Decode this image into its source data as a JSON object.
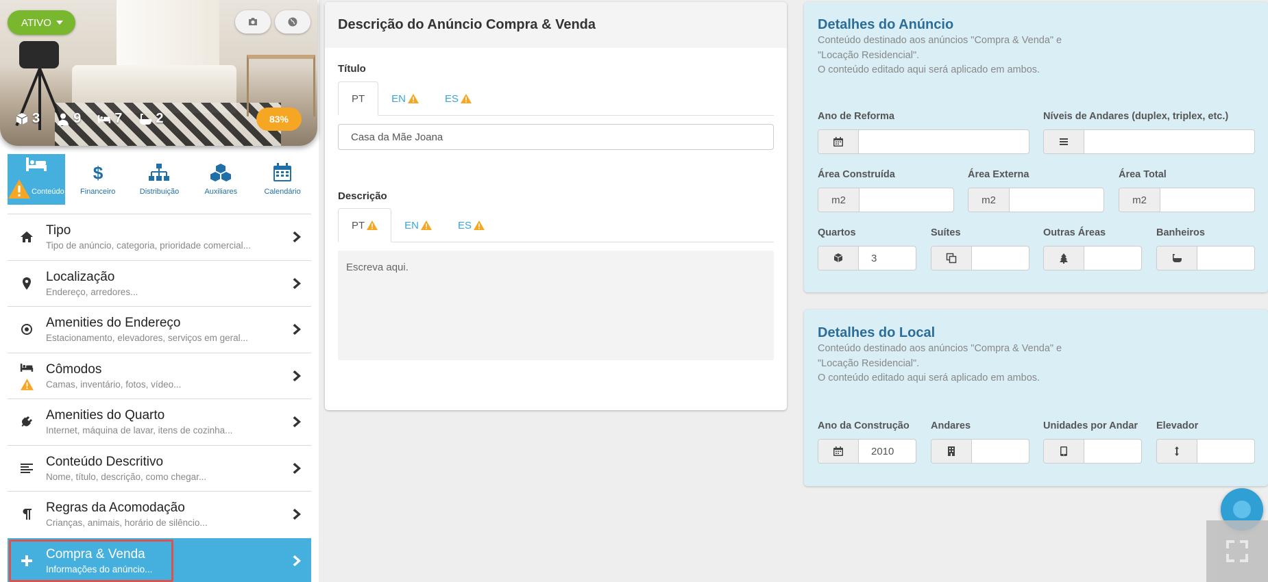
{
  "property": {
    "status_label": "ATIVO",
    "stats": [
      {
        "icon": "cube-icon",
        "value": "3"
      },
      {
        "icon": "person-icon",
        "value": "9"
      },
      {
        "icon": "bed-icon",
        "value": "7"
      },
      {
        "icon": "bathtub-icon",
        "value": "2"
      }
    ],
    "progress": "83%",
    "progress_value": 83
  },
  "tabs": [
    {
      "label": "Conteúdo",
      "icon": "bed-icon",
      "active": true,
      "warning": true
    },
    {
      "label": "Financeiro",
      "icon": "dollar-icon"
    },
    {
      "label": "Distribuição",
      "icon": "sitemap-icon"
    },
    {
      "label": "Auxiliares",
      "icon": "cubes-icon"
    },
    {
      "label": "Calendário",
      "icon": "calendar-icon"
    }
  ],
  "menu": [
    {
      "title": "Tipo",
      "subtitle": "Tipo de anúncio, categoria, prioridade comercial...",
      "icon": "home-icon"
    },
    {
      "title": "Localização",
      "subtitle": "Endereço, arredores...",
      "icon": "map-pin-icon"
    },
    {
      "title": "Amenities do Endereço",
      "subtitle": "Estacionamento, elevadores, serviços em geral...",
      "icon": "target-icon"
    },
    {
      "title": "Cômodos",
      "subtitle": "Camas, inventário, fotos, vídeo...",
      "icon": "bed-icon",
      "warning": true
    },
    {
      "title": "Amenities do Quarto",
      "subtitle": "Internet, máquina de lavar, itens de cozinha...",
      "icon": "plug-icon"
    },
    {
      "title": "Conteúdo Descritivo",
      "subtitle": "Nome, título, descrição, como chegar...",
      "icon": "align-left-icon"
    },
    {
      "title": "Regras da Acomodação",
      "subtitle": "Crianças, animais, horário de silêncio...",
      "icon": "pilcrow-icon"
    },
    {
      "title": "Compra & Venda",
      "subtitle": "Informações do anúncio...",
      "icon": "plus-icon",
      "active": true
    }
  ],
  "description_card": {
    "title": "Descrição do Anúncio Compra & Venda",
    "titulo_label": "Título",
    "titulo_tabs": [
      {
        "label": "PT",
        "active": true,
        "warning": false
      },
      {
        "label": "EN",
        "warning": true
      },
      {
        "label": "ES",
        "warning": true
      }
    ],
    "titulo_value": "Casa da Mãe Joana",
    "descricao_label": "Descrição",
    "descricao_tabs": [
      {
        "label": "PT",
        "active": true,
        "warning": true
      },
      {
        "label": "EN",
        "warning": true
      },
      {
        "label": "ES",
        "warning": true
      }
    ],
    "descricao_placeholder": "Escreva aqui."
  },
  "ad_details": {
    "title": "Detalhes do Anúncio",
    "desc_line1": "Conteúdo destinado aos anúncios \"Compra & Venda\" e",
    "desc_line2": "\"Locação Residencial\".",
    "desc_line3": "O conteúdo editado aqui será aplicado em ambos.",
    "fields": {
      "ano_reforma": {
        "label": "Ano de Reforma",
        "value": "",
        "icon": "calendar-icon"
      },
      "niveis": {
        "label": "Níveis de Andares (duplex, triplex, etc.)",
        "value": "",
        "icon": "bars-icon"
      },
      "area_construida": {
        "label": "Área Construída",
        "unit": "m2",
        "value": ""
      },
      "area_externa": {
        "label": "Área Externa",
        "unit": "m2",
        "value": ""
      },
      "area_total": {
        "label": "Área Total",
        "unit": "m2",
        "value": ""
      },
      "quartos": {
        "label": "Quartos",
        "value": "3",
        "icon": "cube-icon"
      },
      "suites": {
        "label": "Suítes",
        "value": "",
        "icon": "copy-icon"
      },
      "outras_areas": {
        "label": "Outras Áreas",
        "value": "",
        "icon": "tree-icon"
      },
      "banheiros": {
        "label": "Banheiros",
        "value": "",
        "icon": "bathtub-icon"
      }
    }
  },
  "local_details": {
    "title": "Detalhes do Local",
    "desc_line1": "Conteúdo destinado aos anúncios \"Compra & Venda\" e",
    "desc_line2": "\"Locação Residencial\".",
    "desc_line3": "O conteúdo editado aqui será aplicado em ambos.",
    "fields": {
      "ano_construcao": {
        "label": "Ano da Construção",
        "value": "2010",
        "icon": "calendar-icon"
      },
      "andares": {
        "label": "Andares",
        "value": "",
        "icon": "building-icon"
      },
      "unidades": {
        "label": "Unidades por Andar",
        "value": "",
        "icon": "tablet-icon"
      },
      "elevador": {
        "label": "Elevador",
        "value": "",
        "icon": "arrows-vertical-icon"
      }
    }
  },
  "colors": {
    "accent": "#45b0dd",
    "status_green": "#79b82e",
    "progress_orange": "#f5a623",
    "warning": "#f5a623",
    "panel_blue": "#daeef6",
    "title_blue": "#2b6d99",
    "highlight_red": "#d9534f"
  }
}
